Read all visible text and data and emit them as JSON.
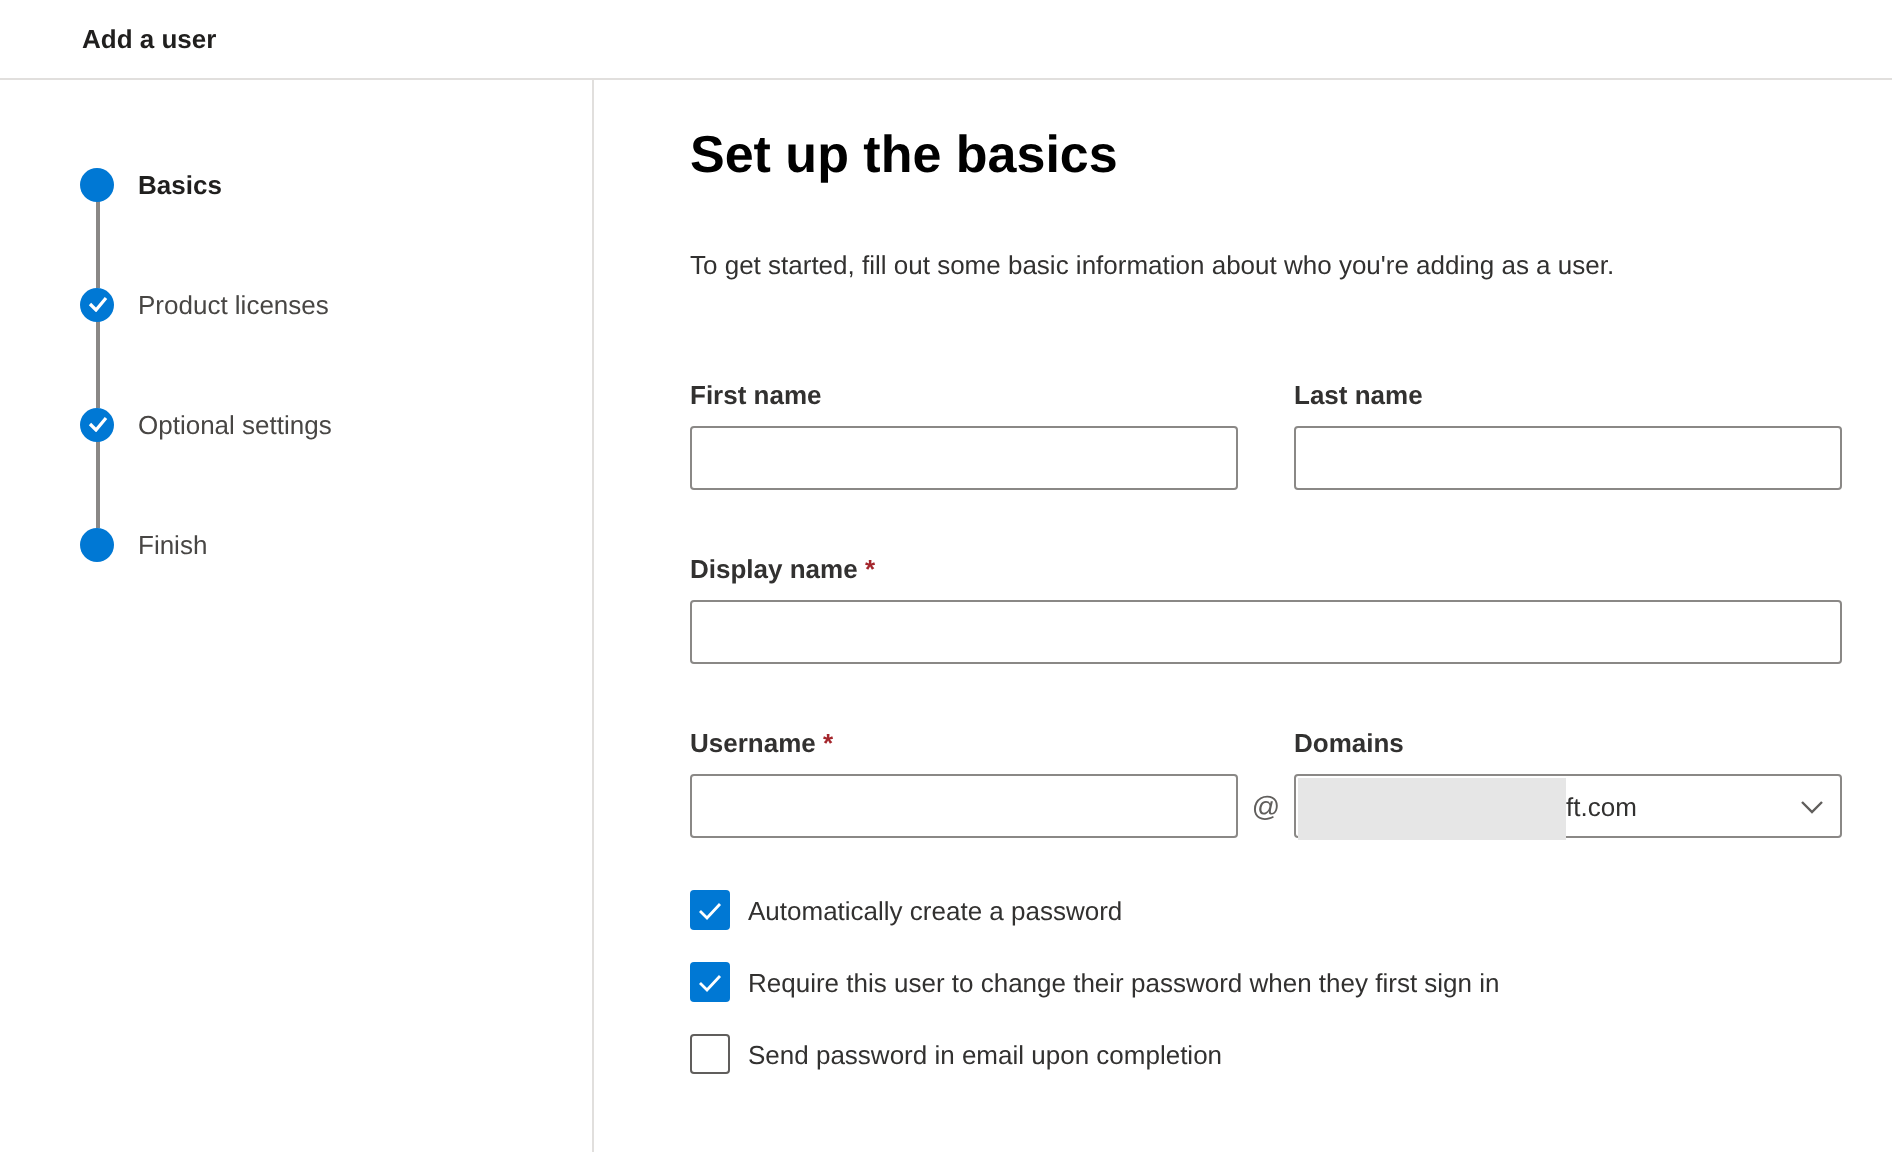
{
  "window": {
    "title": "Add a user"
  },
  "steps": [
    {
      "label": "Basics",
      "kind": "current",
      "selected": true
    },
    {
      "label": "Product licenses",
      "kind": "done",
      "selected": false
    },
    {
      "label": "Optional settings",
      "kind": "done",
      "selected": false
    },
    {
      "label": "Finish",
      "kind": "pending",
      "selected": false
    }
  ],
  "heading": "Set up the basics",
  "description": "To get started, fill out some basic information about who you're adding as a user.",
  "name_fields": [
    {
      "label": "First name"
    },
    {
      "label": "Last name"
    }
  ],
  "display_name": {
    "label": "Display name",
    "required_mark": "*"
  },
  "username": {
    "label": "Username",
    "required_mark": "*"
  },
  "at_sign": "@",
  "domains": {
    "label": "Domains",
    "value": "ft.com",
    "redacted": true
  },
  "checkboxes": [
    {
      "label": "Automatically create a password",
      "checked": true
    },
    {
      "label": "Require this user to change their password when they first sign in",
      "checked": true
    },
    {
      "label": "Send password in email upon completion",
      "checked": false
    }
  ]
}
